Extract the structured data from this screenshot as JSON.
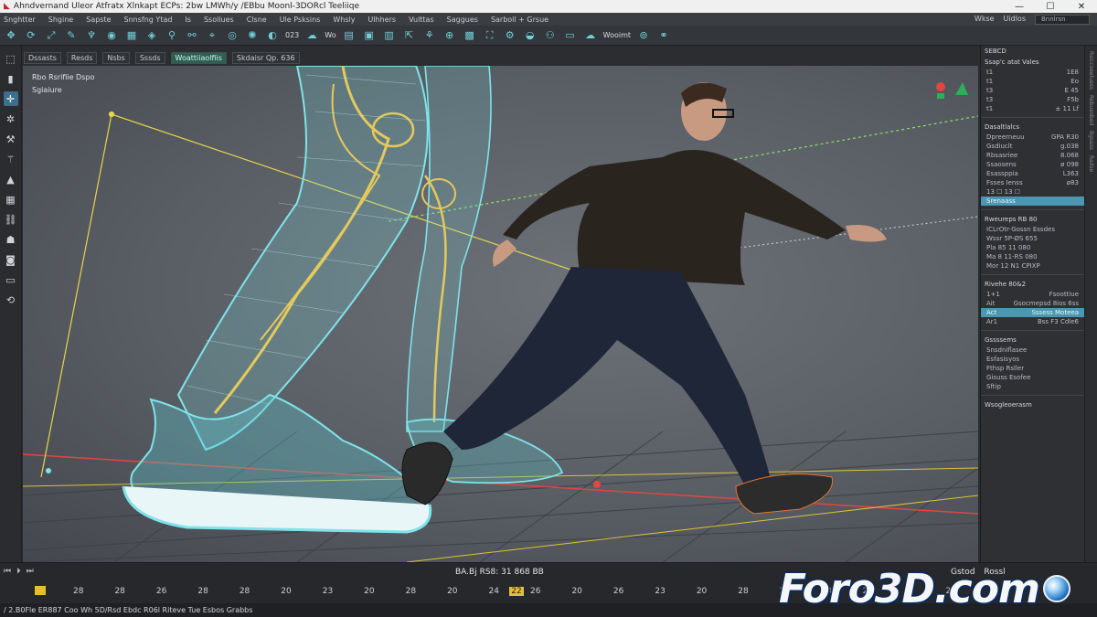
{
  "window": {
    "title": "Ahndvernand Uleor Atfratx Xlnkapt ECPs: 2bw LMWh/y /EBbu Moonl-3DORcl Teeliiqe",
    "min": "—",
    "max": "☐",
    "close": "✕"
  },
  "menu": {
    "items": [
      "Snghtter",
      "Shgine",
      "Sapste",
      "Snnsfng Ytad",
      "Is",
      "Ssoliues",
      "Clsne",
      "Ule Psksins",
      "Whsly",
      "Ulhhers",
      "Vulttas",
      "Saggues",
      "Sarboll + Grsue"
    ],
    "right_items": [
      "Wkse",
      "Uidlos"
    ],
    "search_placeholder": "Bnnlrsn"
  },
  "toolbar": {
    "icons": [
      "move-tool",
      "rotate-tool",
      "scale-tool",
      "paint-tool",
      "brush-tool",
      "skin-tool",
      "mesh-tool",
      "morph-tool",
      "joint-tool",
      "bone-tool",
      "ik-tool",
      "camera-tool",
      "light-tool",
      "material-tool",
      "render-tool",
      "cloth-tool",
      "hair-tool",
      "physics-tool"
    ],
    "text_items": [
      "023",
      "Wo",
      "Wooimt"
    ],
    "more_icons": [
      "export-tool",
      "grid-tool",
      "snap-tool",
      "layer-tool",
      "sculpt-tool",
      "gear-tool",
      "eye-tool",
      "node-tool",
      "keyframe-tool"
    ]
  },
  "subbar": {
    "items": [
      "Dssasts",
      "Resds",
      "Nsbs",
      "Sssds"
    ],
    "active": "Woattiiaolfiis",
    "field": "Skdaisr Qp. 636"
  },
  "left_tools": [
    "select",
    "move",
    "rotate",
    "scale",
    "bone",
    "ik",
    "paint",
    "grid",
    "deform",
    "render",
    "camera"
  ],
  "viewport": {
    "label_1": "Rbo Rsrifiie Dspo",
    "label_2": "Sgiaiure"
  },
  "panel": {
    "header": "SEBCD",
    "section_1": {
      "title": "Ssap'c atat Vales",
      "rows": [
        [
          "t1",
          "1E8"
        ],
        [
          "t1",
          "Eo"
        ],
        [
          "t3",
          "E 45"
        ],
        [
          "t3",
          "F5b"
        ],
        [
          "t1",
          "± 11 Lf"
        ]
      ]
    },
    "section_2": {
      "title": "Dasaltlalcs",
      "rows": [
        [
          "Dpreerneuu",
          "GPA R30"
        ],
        [
          "Gsdiuclt",
          "g.038"
        ],
        [
          "Rbsasriee",
          "8.068"
        ],
        [
          "Ssaosens",
          "ø 098"
        ],
        [
          "Esassppia",
          "L363"
        ],
        [
          "Fsses Ienss",
          "ø83"
        ]
      ],
      "footer": "13 ☐ 13 ☐",
      "dropdown": "Srenaass"
    },
    "section_3": {
      "title": "Rweureps RB 80",
      "rows": [
        "ICLrOtr-Gossn Essdes",
        "Wssr 5P-ØS 655",
        "Pla 85 11 080",
        "Ma 8 11-RS 080",
        "Mor 12 N1 CPIXP"
      ]
    },
    "section_4": {
      "title": "Rivehe 80&2",
      "rows": [
        [
          "1+1",
          "Fsoottiue"
        ],
        [
          "Ait",
          "Gsocmepsd 8ios 6ss"
        ],
        [
          "Act",
          "Sssess Moteea"
        ],
        [
          "Ar1",
          "Bss F3 Cdle6"
        ]
      ]
    },
    "section_5": {
      "title": "Gssssems",
      "rows": [
        "Snsdniflasee",
        "Esfasisyos",
        "Fthsp Rsller",
        "Gisuss Esofee",
        "Sftip"
      ]
    },
    "section_6": {
      "title": "Wsogleoerasm"
    }
  },
  "right_strip": [
    "Rsiccoeeluess",
    "Rebuesbed",
    "Bgsass",
    "Radse"
  ],
  "timeline": {
    "controls": [
      "⏮",
      "⏵",
      "⏭"
    ],
    "header": "BA.Bj RS8: 31 868 BB",
    "right_1": "Gstod",
    "right_2": "Rossl",
    "ticks": [
      "28",
      "28",
      "26",
      "28",
      "28",
      "20",
      "23",
      "20",
      "28",
      "20",
      "24",
      "26",
      "20",
      "26",
      "23",
      "20",
      "28",
      "20",
      "28",
      "20",
      "26",
      "28"
    ],
    "key_tick": "22"
  },
  "statusbar": {
    "text": "/ 2.B0Fle ER887 Coo Wh 5D/Rsd Ebdc R06l Riteve Tue Esbos Grabbs"
  },
  "watermark": {
    "text": "Foro3D.com"
  },
  "colors": {
    "accent": "#4b96b0",
    "key_yellow": "#e6c02c",
    "wireframe_cyan": "#7fe3ea",
    "bone_yellow": "#e4c95c",
    "axis_red": "#e2463f"
  }
}
